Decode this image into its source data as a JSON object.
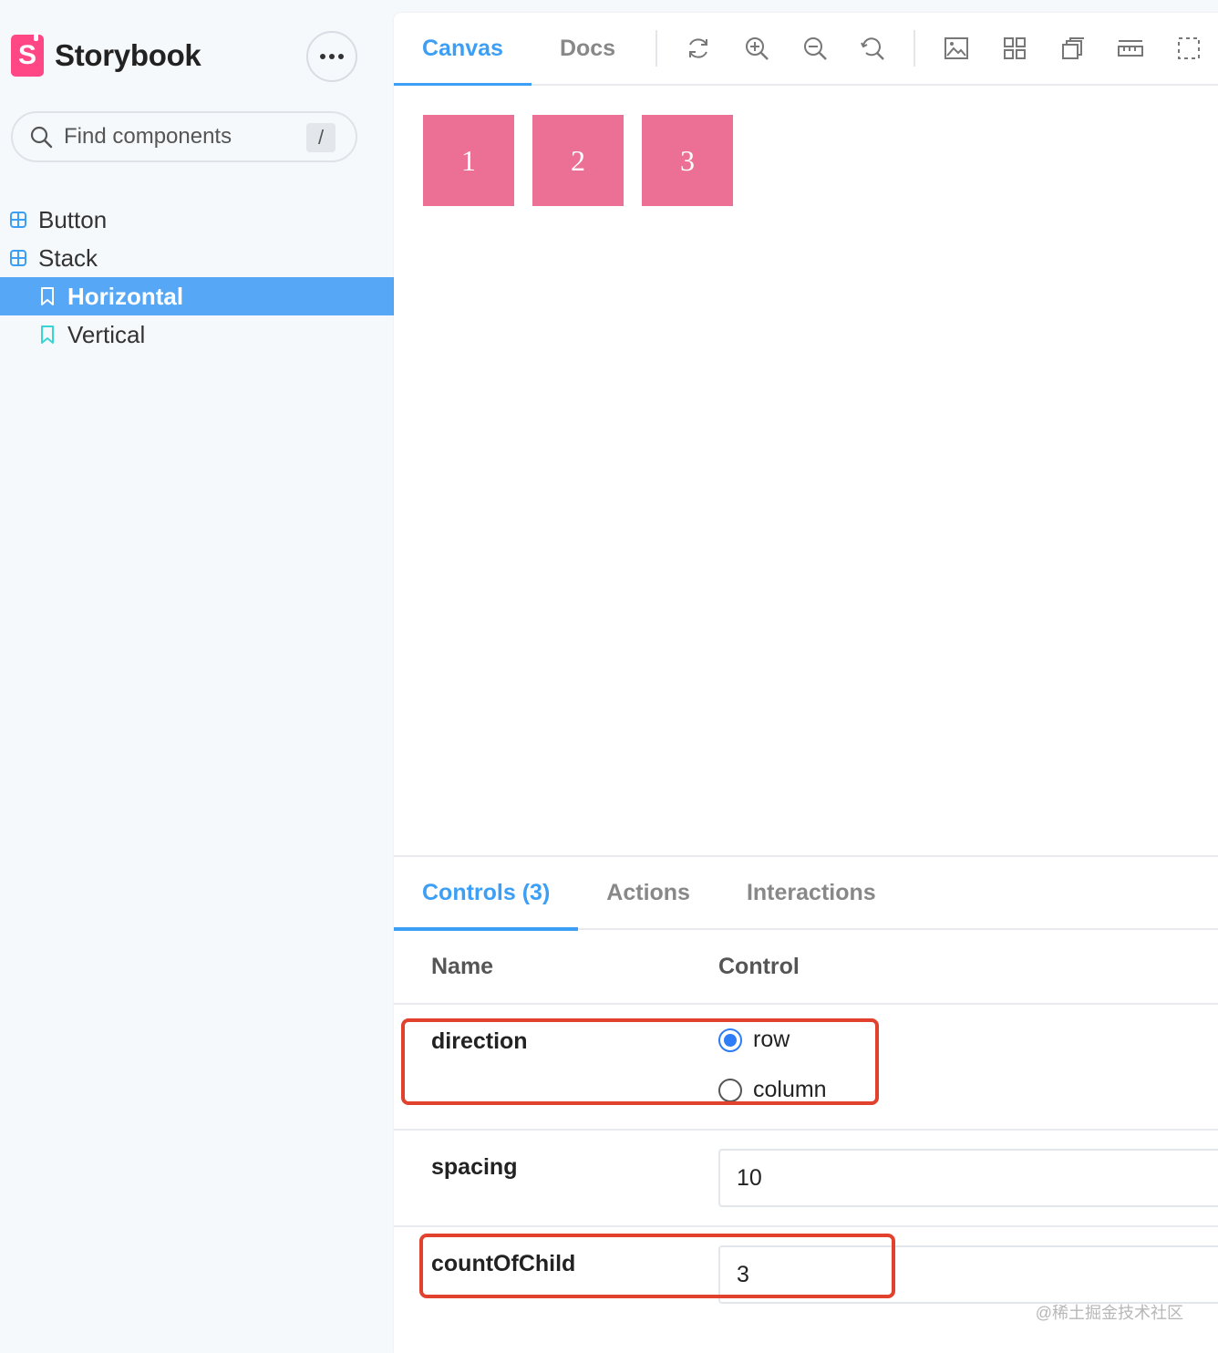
{
  "app": {
    "brand_name": "Storybook",
    "logo_letter": "S",
    "accent_color": "#3c9ff5",
    "brand_color": "#ff4785"
  },
  "sidebar": {
    "search": {
      "placeholder": "Find components",
      "shortcut": "/"
    },
    "items": [
      {
        "label": "Button",
        "icon": "component-icon",
        "selected": false
      },
      {
        "label": "Stack",
        "icon": "component-icon",
        "selected": false
      },
      {
        "label": "Horizontal",
        "icon": "bookmark-icon",
        "selected": true
      },
      {
        "label": "Vertical",
        "icon": "bookmark-icon",
        "selected": false
      }
    ]
  },
  "toolbar": {
    "tabs": [
      {
        "label": "Canvas",
        "active": true
      },
      {
        "label": "Docs",
        "active": false
      }
    ],
    "tools": [
      "reload-icon",
      "zoom-in-icon",
      "zoom-out-icon",
      "zoom-reset-icon",
      "background-icon",
      "grid-icon",
      "viewport-icon",
      "measure-icon",
      "outline-icon"
    ]
  },
  "canvas": {
    "children": [
      "1",
      "2",
      "3"
    ],
    "child_color": "#ec7096"
  },
  "addons": {
    "tabs": [
      {
        "label": "Controls (3)",
        "active": true
      },
      {
        "label": "Actions",
        "active": false
      },
      {
        "label": "Interactions",
        "active": false
      }
    ],
    "table": {
      "col_name": "Name",
      "col_control": "Control",
      "direction": {
        "name": "direction",
        "options": [
          "row",
          "column"
        ],
        "selected": "row"
      },
      "spacing": {
        "name": "spacing",
        "value": "10"
      },
      "count": {
        "name": "countOfChild",
        "value": "3"
      }
    }
  },
  "watermark": "@稀土掘金技术社区"
}
